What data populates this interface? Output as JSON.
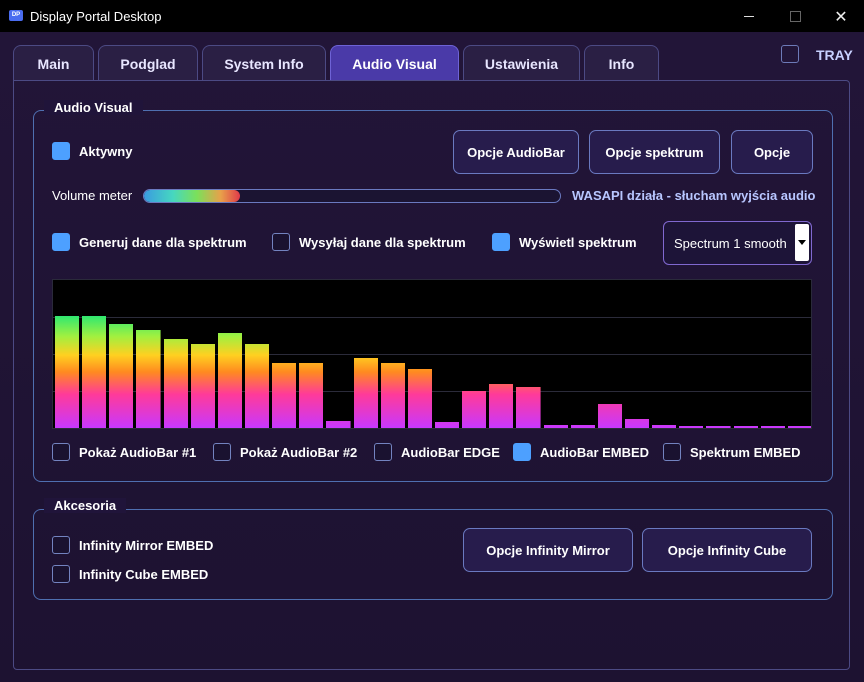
{
  "window": {
    "app_icon_text": "DP",
    "title": "Display Portal Desktop",
    "minimize_icon": "minimize-icon",
    "maximize_icon": "maximize-icon",
    "close_icon": "close-icon",
    "close_glyph": "✕"
  },
  "tabs": [
    {
      "label": "Main",
      "active": false
    },
    {
      "label": "Podglad",
      "active": false
    },
    {
      "label": "System Info",
      "active": false
    },
    {
      "label": "Audio Visual",
      "active": true
    },
    {
      "label": "Ustawienia",
      "active": false
    },
    {
      "label": "Info",
      "active": false
    }
  ],
  "tray": {
    "label": "TRAY",
    "checked": false
  },
  "audio_visual": {
    "group_title": "Audio Visual",
    "aktywny": {
      "label": "Aktywny",
      "checked": true
    },
    "buttons": {
      "audiobar": "Opcje AudioBar",
      "spektrum": "Opcje spektrum",
      "opcje": "Opcje"
    },
    "volume": {
      "label": "Volume meter",
      "level": 0.23
    },
    "status": "WASAPI działa - słucham wyjścia audio",
    "generuj": {
      "label": "Generuj dane dla spektrum",
      "checked": true
    },
    "wysylaj": {
      "label": "Wysyłaj dane dla spektrum",
      "checked": false
    },
    "wyswietl": {
      "label": "Wyświetl spektrum",
      "checked": true
    },
    "spectrum_mode": {
      "selected": "Spectrum 1 smooth"
    },
    "spectrum_levels": [
      0.76,
      0.76,
      0.7,
      0.66,
      0.6,
      0.57,
      0.64,
      0.57,
      0.44,
      0.44,
      0.05,
      0.47,
      0.44,
      0.4,
      0.04,
      0.25,
      0.3,
      0.28,
      0.02,
      0.02,
      0.16,
      0.06,
      0.02,
      0.01,
      0.01,
      0.01,
      0.01,
      0.01
    ],
    "checkboxes_bottom": [
      {
        "label": "Pokaż AudioBar #1",
        "checked": false
      },
      {
        "label": "Pokaż AudioBar #2",
        "checked": false
      },
      {
        "label": "AudioBar EDGE",
        "checked": false
      },
      {
        "label": "AudioBar EMBED",
        "checked": true
      },
      {
        "label": "Spektrum EMBED",
        "checked": false
      }
    ]
  },
  "akcesoria": {
    "group_title": "Akcesoria",
    "mirror": {
      "label": "Infinity Mirror EMBED",
      "checked": false
    },
    "cube": {
      "label": "Infinity Cube EMBED",
      "checked": false
    },
    "buttons": {
      "mirror": "Opcje Infinity Mirror",
      "cube": "Opcje Infinity Cube"
    }
  },
  "colors": {
    "accent": "#4a3aa8",
    "checkbox_checked": "#4da0ff",
    "status_text": "#b8c6ff"
  }
}
